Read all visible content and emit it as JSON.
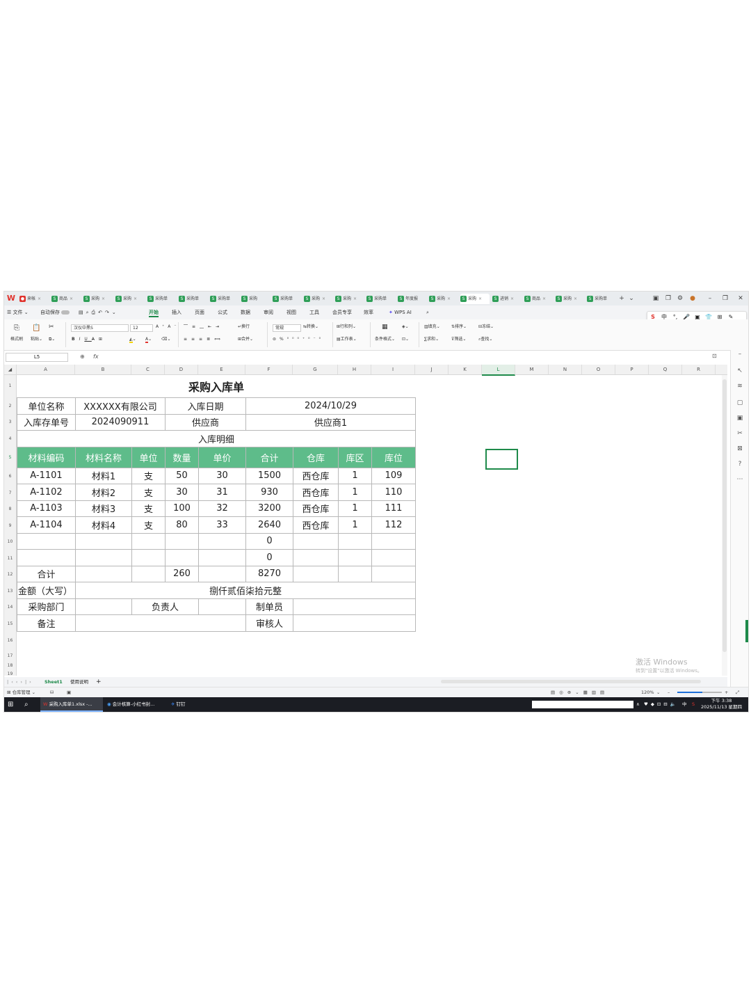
{
  "tabbar": {
    "tabs": [
      "来帐",
      "商品",
      "采购",
      "采购",
      "采购单",
      "采购单",
      "采购单",
      "采购",
      "采购单",
      "采购",
      "采购",
      "采购单",
      "年度报",
      "采购",
      "采购",
      "进销",
      "商品",
      "采购",
      "采购单"
    ],
    "new_tab": "+"
  },
  "menubar": {
    "file": "文件",
    "autosave": "自动保存",
    "items": [
      "开始",
      "插入",
      "页面",
      "公式",
      "数据",
      "审阅",
      "视图",
      "工具",
      "会员专享",
      "效率",
      "WPS AI"
    ],
    "active": "开始"
  },
  "ime": [
    "中",
    "°,",
    "☺",
    "▣",
    "✉",
    "⊞"
  ],
  "ribbon": {
    "format_painter": "格式刷",
    "paste": "粘贴",
    "font_name": "汉仪中黑S",
    "font_size": "12",
    "wrap": "换行",
    "merge": "合并",
    "number_format": "常规",
    "convert": "转换",
    "row_col": "行和列",
    "worksheet": "工作表",
    "cond_format": "条件格式",
    "fill": "填充",
    "sort": "排序",
    "freeze": "冻结",
    "sum": "求和",
    "filter": "筛选",
    "find": "查找"
  },
  "formula_bar": {
    "name_box": "L5",
    "fx": "fx",
    "content": ""
  },
  "columns": [
    "A",
    "B",
    "C",
    "D",
    "E",
    "F",
    "G",
    "H",
    "I",
    "J",
    "K",
    "L",
    "M",
    "N",
    "O",
    "P",
    "Q",
    "R"
  ],
  "selected_column": "L",
  "rows": [
    "1",
    "2",
    "3",
    "4",
    "5",
    "6",
    "7",
    "8",
    "9",
    "10",
    "11",
    "12",
    "13",
    "14",
    "15",
    "16",
    "17",
    "18",
    "19"
  ],
  "sheet": {
    "title": "采购入库单",
    "unit_label": "单位名称",
    "unit_value": "XXXXXX有限公司",
    "date_label": "入库日期",
    "date_value": "2024/10/29",
    "doc_label": "入库存单号",
    "doc_value": "2024090911",
    "supplier_label": "供应商",
    "supplier_value": "供应商1",
    "detail_label": "入库明细",
    "headers": [
      "材料编码",
      "材料名称",
      "单位",
      "数量",
      "单价",
      "合计",
      "仓库",
      "库区",
      "库位"
    ],
    "items": [
      [
        "A-1101",
        "材料1",
        "支",
        "50",
        "30",
        "1500",
        "西仓库",
        "1",
        "109"
      ],
      [
        "A-1102",
        "材料2",
        "支",
        "30",
        "31",
        "930",
        "西仓库",
        "1",
        "110"
      ],
      [
        "A-1103",
        "材料3",
        "支",
        "100",
        "32",
        "3200",
        "西仓库",
        "1",
        "111"
      ],
      [
        "A-1104",
        "材料4",
        "支",
        "80",
        "33",
        "2640",
        "西仓库",
        "1",
        "112"
      ],
      [
        "",
        "",
        "",
        "",
        "",
        "0",
        "",
        "",
        ""
      ],
      [
        "",
        "",
        "",
        "",
        "",
        "0",
        "",
        "",
        ""
      ]
    ],
    "total_label": "合计",
    "total_qty": "260",
    "total_amount": "8270",
    "amount_words_label": "金额（大写）",
    "amount_words_value": "捌仟贰佰柒拾元整",
    "dept_label": "采购部门",
    "owner_label": "负责人",
    "maker_label": "制单员",
    "remark_label": "备注",
    "reviewer_label": "审核人"
  },
  "watermark": {
    "title": "激活 Windows",
    "subtitle": "转到\"设置\"以激活 Windows。"
  },
  "sheet_tabs": [
    "Sheet1",
    "使用说明"
  ],
  "active_sheet": "Sheet1",
  "statusbar": {
    "left": "仓库管理",
    "zoom": "120%"
  },
  "taskbar": {
    "apps": [
      "采购入库单1.xlsx -...",
      "会计核算-小红书封...",
      "钉钉"
    ],
    "time": "下午 3:38",
    "date": "2025/11/13 星期四",
    "tray": [
      "∧",
      "中",
      "S"
    ]
  },
  "colors": {
    "accent": "#1e8a4a",
    "header_fill": "#5ebc8a",
    "taskbar": "#1b1d23"
  }
}
